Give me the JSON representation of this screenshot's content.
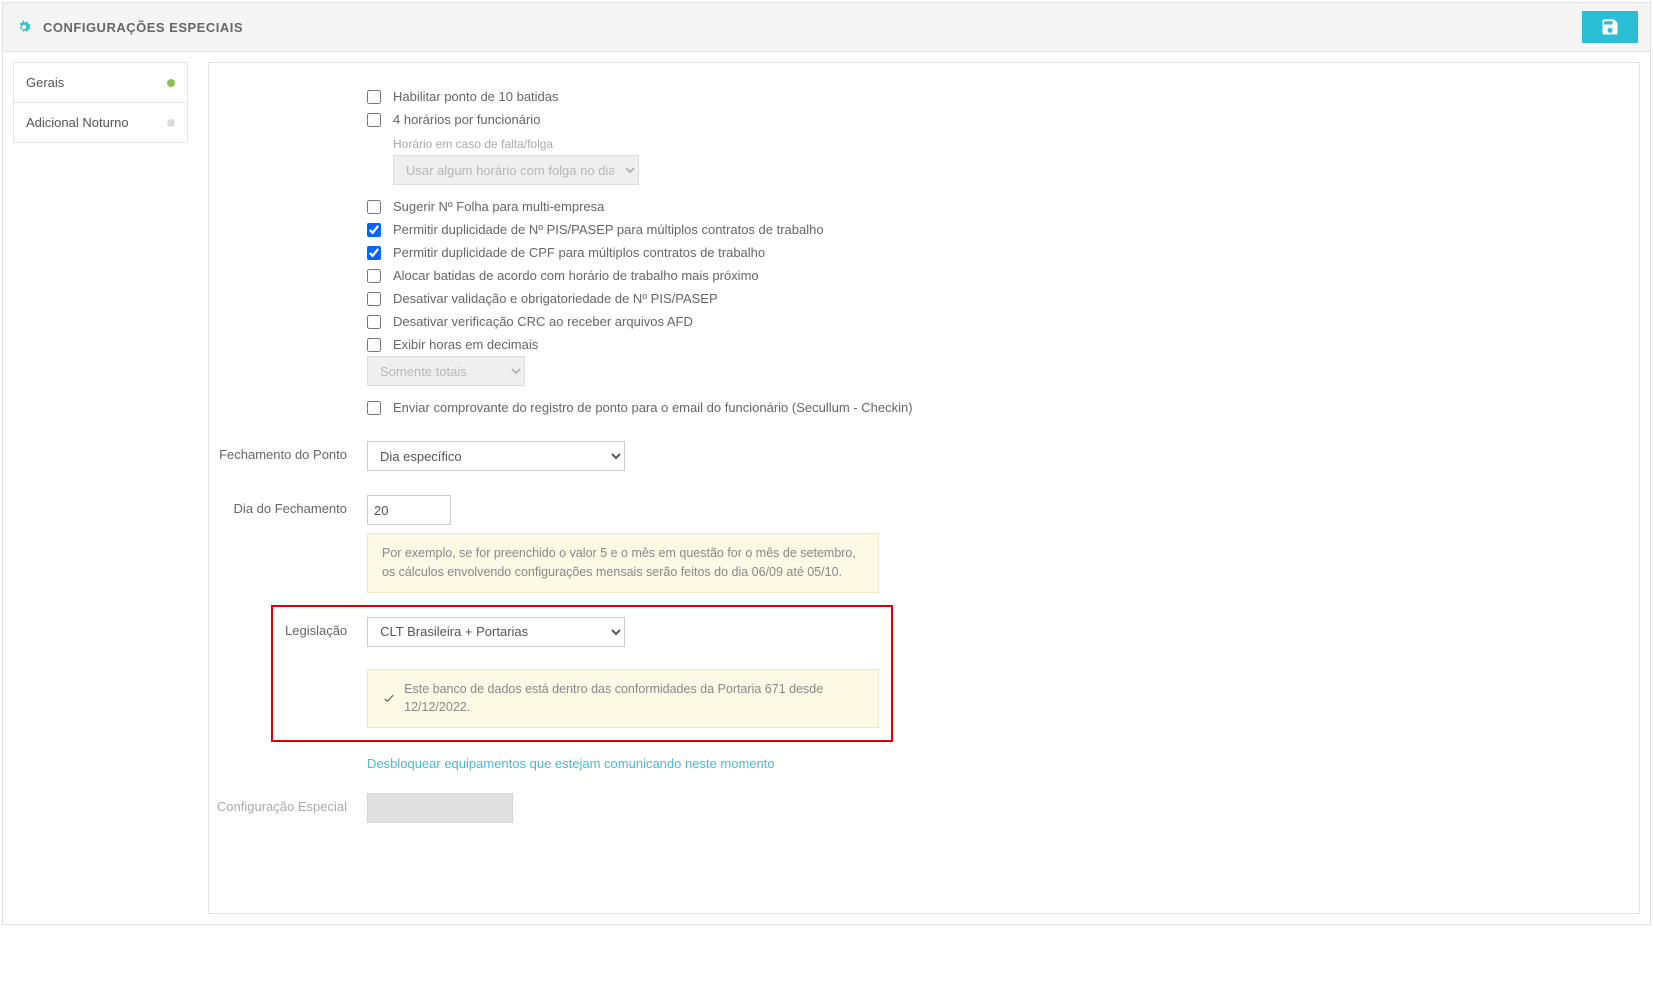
{
  "header": {
    "title": "CONFIGURAÇÕES ESPECIAIS"
  },
  "sidebar": {
    "items": [
      {
        "label": "Gerais",
        "active": true
      },
      {
        "label": "Adicional Noturno",
        "active": false
      }
    ]
  },
  "checkboxes": {
    "c0": {
      "label": "Habilitar ponto de 10 batidas",
      "checked": false
    },
    "c1": {
      "label": "4 horários por funcionário",
      "checked": false
    },
    "c1_sub": "Horário em caso de falta/folga",
    "c1_select": "Usar algum horário com folga no dia",
    "c2": {
      "label": "Sugerir Nº Folha para multi-empresa",
      "checked": false
    },
    "c3": {
      "label": "Permitir duplicidade de Nº PIS/PASEP para múltiplos contratos de trabalho",
      "checked": true
    },
    "c4": {
      "label": "Permitir duplicidade de CPF para múltiplos contratos de trabalho",
      "checked": true
    },
    "c5": {
      "label": "Alocar batidas de acordo com horário de trabalho mais próximo",
      "checked": false
    },
    "c6": {
      "label": "Desativar validação e obrigatoriedade de Nº PIS/PASEP",
      "checked": false
    },
    "c7": {
      "label": "Desativar verificação CRC ao receber arquivos AFD",
      "checked": false
    },
    "c8": {
      "label": "Exibir horas em decimais",
      "checked": false
    },
    "c8_select": "Somente totais",
    "c9": {
      "label": "Enviar comprovante do registro de ponto para o email do funcionário (Secullum - Checkin)",
      "checked": false
    }
  },
  "fields": {
    "fechamento_label": "Fechamento do Ponto",
    "fechamento_value": "Dia específico",
    "dia_label": "Dia do Fechamento",
    "dia_value": "20",
    "dia_info": "Por exemplo, se for preenchido o valor 5 e o mês em questão for o mês de setembro, os cálculos envolvendo configurações mensais serão feitos do dia 06/09 até 05/10.",
    "legislacao_label": "Legislação",
    "legislacao_value": "CLT Brasileira + Portarias",
    "compliance_msg": "Este banco de dados está dentro das conformidades da Portaria 671 desde 12/12/2022.",
    "unlock_link": "Desbloquear equipamentos que estejam comunicando neste momento",
    "config_especial_label": "Configuração Especial"
  }
}
